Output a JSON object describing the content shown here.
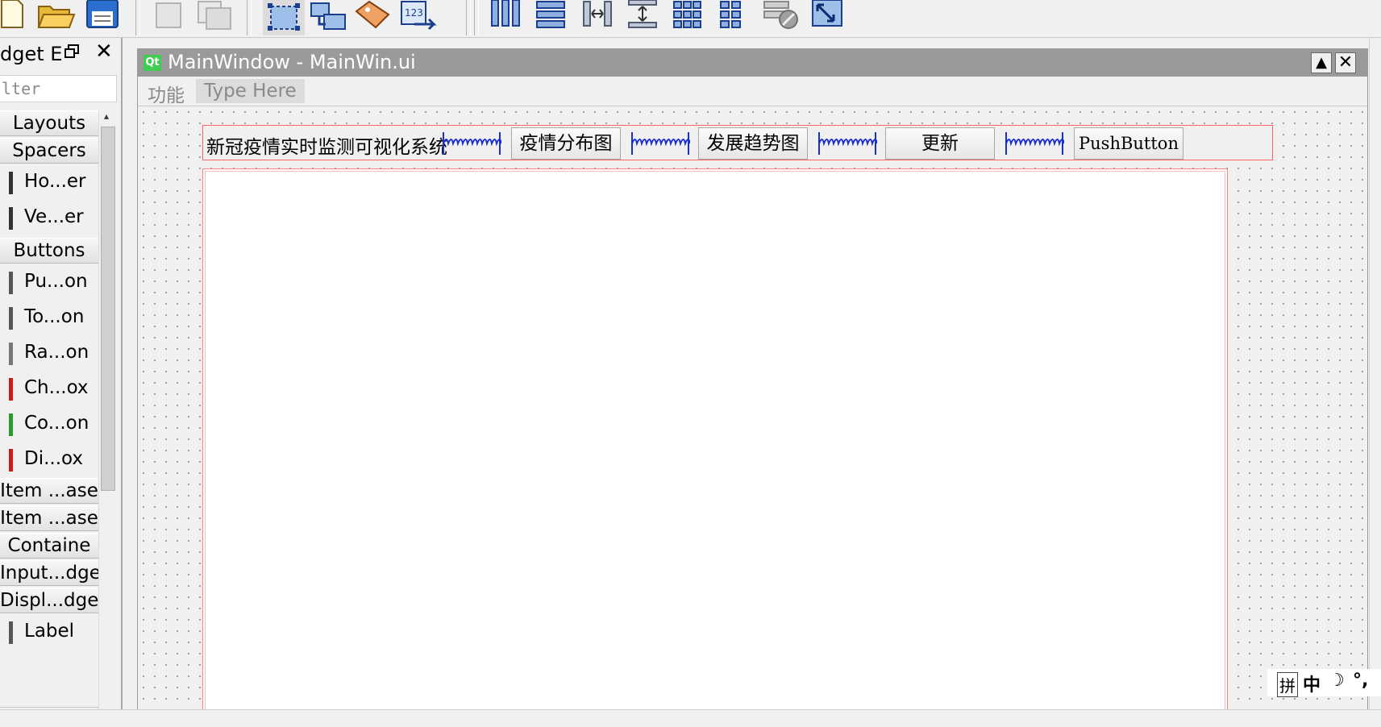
{
  "form": {
    "window_title": "MainWindow - MainWin.ui",
    "qt_badge": "Qt",
    "menu": [
      "功能",
      "Type Here"
    ],
    "header_label": "新冠疫情实时监测可视化系统",
    "buttons": [
      "疫情分布图",
      "发展趋势图",
      "更新",
      "PushButton"
    ]
  },
  "widget_box": {
    "title": "dget E",
    "filter_placeholder": "lter",
    "entries": [
      {
        "kind": "category",
        "label": "Layouts"
      },
      {
        "kind": "category",
        "label": "Spacers"
      },
      {
        "kind": "item",
        "label": "Ho...er",
        "icon": "horizontal-spacer-icon"
      },
      {
        "kind": "item",
        "label": "Ve...er",
        "icon": "vertical-spacer-icon"
      },
      {
        "kind": "category",
        "label": "Buttons"
      },
      {
        "kind": "item",
        "label": "Pu...on",
        "icon": "push-button-icon"
      },
      {
        "kind": "item",
        "label": "To...on",
        "icon": "tool-button-icon"
      },
      {
        "kind": "item",
        "label": "Ra...on",
        "icon": "radio-button-icon"
      },
      {
        "kind": "item",
        "label": "Ch...ox",
        "icon": "check-box-icon"
      },
      {
        "kind": "item",
        "label": "Co...on",
        "icon": "command-link-icon"
      },
      {
        "kind": "item",
        "label": "Di...ox",
        "icon": "dialog-button-box-icon"
      },
      {
        "kind": "category",
        "label": "Item ...ase"
      },
      {
        "kind": "category",
        "label": "Item ...ase"
      },
      {
        "kind": "category",
        "label": "Containe"
      },
      {
        "kind": "category",
        "label": "Input...dge"
      },
      {
        "kind": "category",
        "label": "Displ...dge"
      },
      {
        "kind": "item",
        "label": "Label",
        "icon": "label-icon"
      }
    ]
  },
  "ime": {
    "mode": "拼",
    "lang": "中"
  },
  "toolbar_icons": [
    "new-file-icon",
    "open-folder-icon",
    "save-icon",
    "cut-icon",
    "copy-icon",
    "edit-widgets-icon",
    "edit-signals-slots-icon",
    "edit-buddies-icon",
    "edit-tab-order-icon",
    "layout-horizontal-icon",
    "layout-vertical-icon",
    "split-horizontal-icon",
    "split-vertical-icon",
    "layout-grid-icon",
    "layout-form-icon",
    "break-layout-icon",
    "adjust-size-icon"
  ]
}
